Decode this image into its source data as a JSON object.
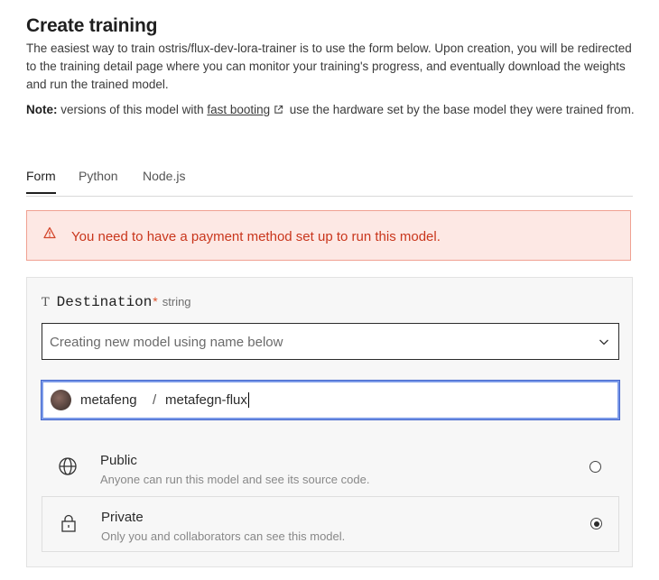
{
  "header": {
    "title": "Create training",
    "description": "The easiest way to train ostris/flux-dev-lora-trainer is to use the form below. Upon creation, you will be redirected to the training detail page where you can monitor your training's progress, and eventually download the weights and run the trained model.",
    "note_label": "Note:",
    "note_pre": "versions of this model with",
    "note_link": "fast booting",
    "note_post": "use the hardware set by the base model they were trained from."
  },
  "tabs": [
    {
      "label": "Form",
      "active": true
    },
    {
      "label": "Python",
      "active": false
    },
    {
      "label": "Node.js",
      "active": false
    }
  ],
  "alert": {
    "message": "You need to have a payment method set up to run this model.",
    "icon": "warning-icon",
    "color": "#c9361c"
  },
  "destination": {
    "type_icon": "T",
    "name": "Destination",
    "required_mark": "*",
    "type": "string",
    "select_value": "Creating new model using name below",
    "owner": "metafeng",
    "separator": "/",
    "model_name": "metafegn-flux"
  },
  "visibility": [
    {
      "title": "Public",
      "description": "Anyone can run this model and see its source code.",
      "icon": "globe-icon",
      "checked": false
    },
    {
      "title": "Private",
      "description": "Only you and collaborators can see this model.",
      "icon": "lock-icon",
      "checked": true
    }
  ]
}
